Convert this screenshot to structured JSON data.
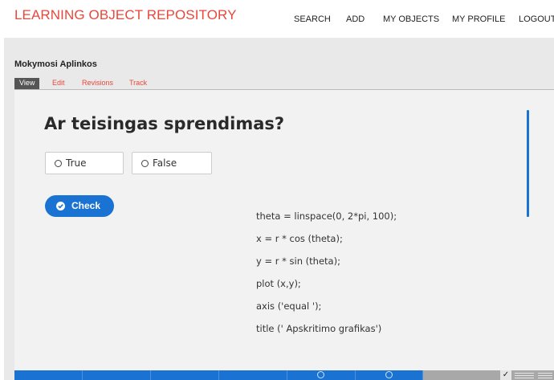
{
  "header": {
    "brand": "LEARNING OBJECT REPOSITORY",
    "brand_color": "#e8483c",
    "nav": [
      "SEARCH",
      "ADD",
      "MY OBJECTS",
      "MY PROFILE",
      "LOGOUT"
    ]
  },
  "object": {
    "title": "Mokymosi Aplinkos",
    "tabs": [
      "View",
      "Edit",
      "Revisions",
      "Track"
    ],
    "active_tab": "View"
  },
  "activity": {
    "question": "Ar teisingas sprendimas?",
    "options": [
      "True",
      "False"
    ],
    "check_label": "Check",
    "accent_color": "#1a73d2"
  },
  "code": [
    "theta = linspace(0, 2*pi, 100);",
    "x = r * cos (theta);",
    "y = r * sin (theta);",
    "plot (x,y);",
    "axis ('equal ');",
    "title (' Apskritimo grafikas')"
  ],
  "footer_bar": {
    "check_mark": "✓"
  }
}
